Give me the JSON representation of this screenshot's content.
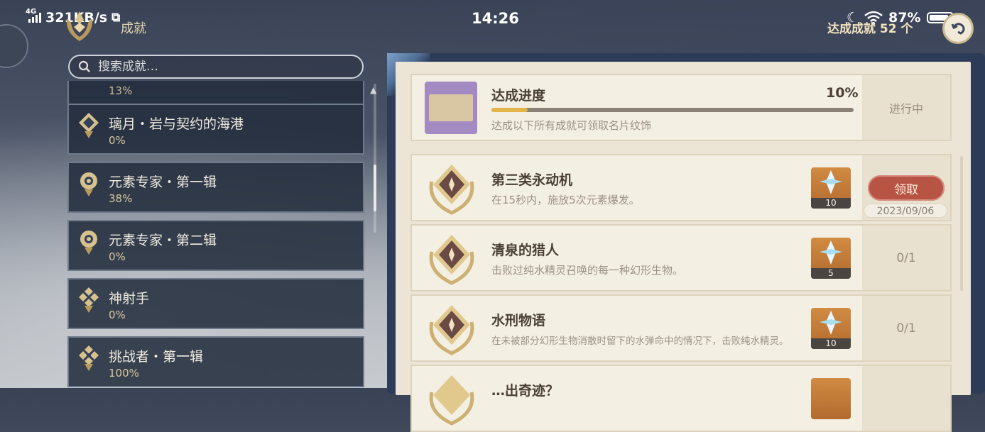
{
  "statusbar": {
    "network": "4G",
    "speed": "321KB/s",
    "time": "14:26",
    "battery": "87%"
  },
  "header": {
    "title": "成就",
    "completed_label": "达成成就 52 个"
  },
  "search": {
    "placeholder": "搜索成就…"
  },
  "categories": [
    {
      "name": "",
      "percent": "13%"
    },
    {
      "name": "璃月・岩与契约的海港",
      "percent": "0%"
    },
    {
      "name": "元素专家・第一辑",
      "percent": "38%"
    },
    {
      "name": "元素专家・第二辑",
      "percent": "0%"
    },
    {
      "name": "神射手",
      "percent": "0%"
    },
    {
      "name": "挑战者・第一辑",
      "percent": "100%"
    }
  ],
  "progress": {
    "title": "达成进度",
    "percent": "10%",
    "value": 0.1,
    "description": "达成以下所有成就可领取名片纹饰",
    "status": "进行中"
  },
  "achievements": [
    {
      "name": "第三类永动机",
      "description": "在15秒内，施放5次元素爆发。",
      "reward": "10",
      "claim_label": "领取",
      "date": "2023/09/06"
    },
    {
      "name": "清泉的猎人",
      "description": "击败过纯水精灵召唤的每一种幻形生物。",
      "reward": "5",
      "status": "0/1"
    },
    {
      "name": "水刑物语",
      "description": "在未被部分幻形生物消散时留下的水弹命中的情况下，击败纯水精灵。",
      "reward": "10",
      "status": "0/1"
    },
    {
      "name": "…出奇迹？",
      "description": "",
      "reward": ""
    }
  ],
  "colors": {
    "accent_gold": "#e3b44a",
    "claim_red": "#b85443",
    "panel_bg": "#ece5d6"
  }
}
